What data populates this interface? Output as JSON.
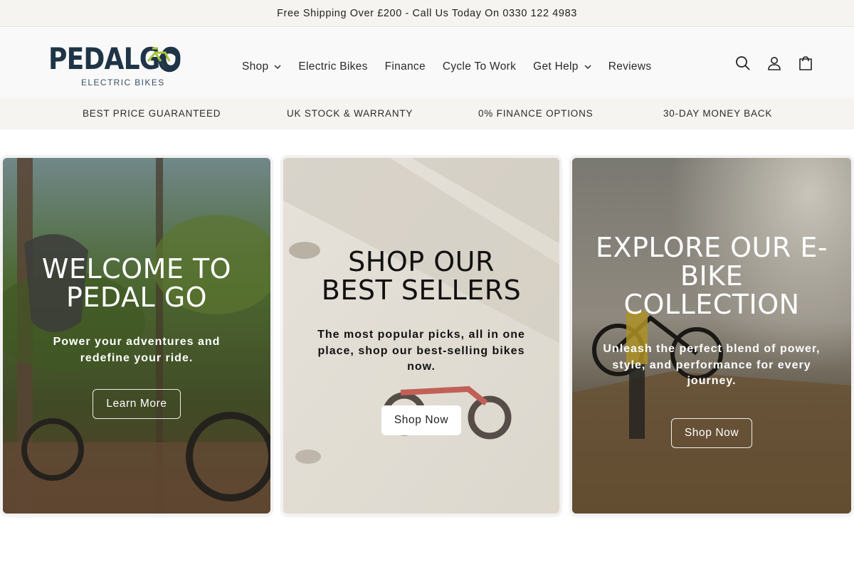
{
  "announcement": {
    "text": "Free Shipping Over £200 - Call Us Today On 0330 122 4983"
  },
  "logo": {
    "word": "PEDALGO",
    "sub": "ELECTRIC BIKES",
    "colors": {
      "primary": "#1f3547",
      "accent": "#a8c53a"
    }
  },
  "nav": {
    "items": [
      {
        "label": "Shop",
        "has_dropdown": true
      },
      {
        "label": "Electric Bikes",
        "has_dropdown": false
      },
      {
        "label": "Finance",
        "has_dropdown": false
      },
      {
        "label": "Cycle To Work",
        "has_dropdown": false
      },
      {
        "label": "Get Help",
        "has_dropdown": true
      },
      {
        "label": "Reviews",
        "has_dropdown": false
      }
    ]
  },
  "header_icons": [
    "search-icon",
    "account-icon",
    "cart-icon"
  ],
  "usps": [
    "BEST PRICE GUARANTEED",
    "UK STOCK & WARRANTY",
    "0% FINANCE OPTIONS",
    "30-DAY MONEY BACK"
  ],
  "cards": [
    {
      "title": "WELCOME TO PEDAL GO",
      "subtitle": "Power your adventures and redefine your ride.",
      "button": "Learn More"
    },
    {
      "title": "SHOP OUR BEST SELLERS",
      "subtitle": "The most popular picks, all in one place, shop our best-selling bikes now.",
      "button": "Shop Now"
    },
    {
      "title": "EXPLORE OUR E-BIKE COLLECTION",
      "subtitle": "Unleash the perfect blend of power, style, and performance for every journey.",
      "button": "Shop Now"
    }
  ]
}
